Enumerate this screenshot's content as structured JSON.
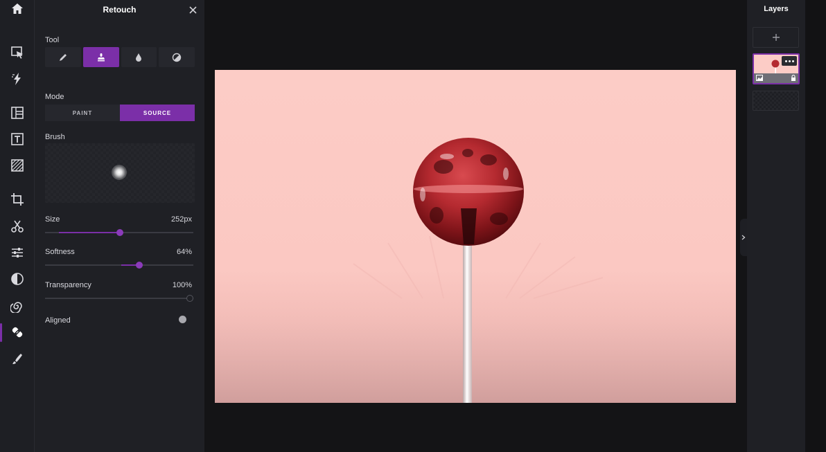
{
  "panel": {
    "title": "Retouch",
    "tool_label": "Tool",
    "tools": [
      "pencil-icon",
      "clone-stamp-icon",
      "blur-drop-icon",
      "dodge-burn-icon"
    ],
    "active_tool": "clone-stamp-icon",
    "mode_label": "Mode",
    "modes": [
      "PAINT",
      "SOURCE"
    ],
    "active_mode": "SOURCE",
    "brush_label": "Brush",
    "size": {
      "label": "Size",
      "value": "252px",
      "level": 0.5
    },
    "softness": {
      "label": "Softness",
      "value": "64%",
      "level": 0.64
    },
    "transparency": {
      "label": "Transparency",
      "value": "100%",
      "level": 1.0
    },
    "aligned": {
      "label": "Aligned",
      "on": true
    }
  },
  "rail": {
    "items": [
      "home-icon",
      "select-icon",
      "quick-actions-icon",
      "layout-icon",
      "text-icon",
      "texture-icon",
      "crop-icon",
      "cutout-icon",
      "adjust-icon",
      "filter-icon",
      "effects-icon",
      "retouch-icon",
      "paint-icon"
    ],
    "active": "retouch-icon"
  },
  "layers": {
    "title": "Layers",
    "add_label": "+"
  },
  "colors": {
    "accent": "#7b2fa8",
    "panel_bg": "#1f2025",
    "canvas_bg": "#fcccc6"
  }
}
